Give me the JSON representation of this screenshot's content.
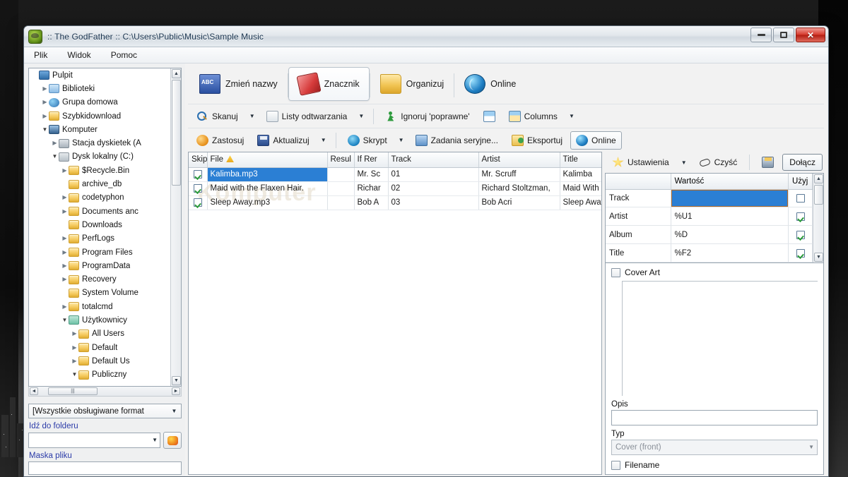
{
  "window": {
    "title": ":: The GodFather ::   C:\\Users\\Public\\Music\\Sample Music",
    "icon": "godfather-app-icon",
    "controls": {
      "minimize": "–",
      "restore": "❐",
      "close": "✕"
    }
  },
  "menubar": {
    "items": [
      "Plik",
      "Widok",
      "Pomoc"
    ]
  },
  "tabs": [
    {
      "label": "Zmień nazwy",
      "icon": "rename-icon",
      "active": false
    },
    {
      "label": "Znacznik",
      "icon": "tag-icon",
      "active": true
    },
    {
      "label": "Organizuj",
      "icon": "folder-music-icon",
      "active": false
    },
    {
      "label": "Online",
      "icon": "globe-icon",
      "active": false
    }
  ],
  "toolbar_row2": [
    {
      "label": "Skanuj",
      "icon": "search-icon",
      "caret": true
    },
    {
      "label": "Listy odtwarzania",
      "icon": "playlist-icon",
      "caret": true
    },
    {
      "label": "Ignoruj 'poprawne'",
      "icon": "run-icon",
      "caret": false
    },
    {
      "label": "",
      "icon": "window-blue-icon",
      "caret": false
    },
    {
      "label": "Columns",
      "icon": "columns-icon",
      "caret": true
    }
  ],
  "toolbar_row3": [
    {
      "label": "Zastosuj",
      "icon": "apply-icon",
      "caret": false
    },
    {
      "label": "Aktualizuj",
      "icon": "save-icon",
      "caret": true
    },
    {
      "label": "Skrypt",
      "icon": "script-icon",
      "caret": true
    },
    {
      "label": "Zadania seryjne...",
      "icon": "batch-icon",
      "caret": false
    },
    {
      "label": "Eksportuj",
      "icon": "export-icon",
      "caret": false
    },
    {
      "label": "Online",
      "icon": "online-icon",
      "caret": false,
      "framed": true
    }
  ],
  "tree": {
    "nodes": [
      {
        "label": "Pulpit",
        "depth": 0,
        "arrow": "",
        "icon": "desktop-icon"
      },
      {
        "label": "Biblioteki",
        "depth": 1,
        "arrow": "closed",
        "icon": "library-icon"
      },
      {
        "label": "Grupa domowa",
        "depth": 1,
        "arrow": "closed",
        "icon": "homegroup-icon"
      },
      {
        "label": "Szybkidownload",
        "depth": 1,
        "arrow": "closed",
        "icon": "folder-icon"
      },
      {
        "label": "Komputer",
        "depth": 1,
        "arrow": "open",
        "icon": "computer-icon"
      },
      {
        "label": "Stacja dyskietek (A",
        "depth": 2,
        "arrow": "closed",
        "icon": "floppy-icon"
      },
      {
        "label": "Dysk lokalny (C:)",
        "depth": 2,
        "arrow": "open",
        "icon": "drive-icon"
      },
      {
        "label": "$Recycle.Bin",
        "depth": 3,
        "arrow": "closed",
        "icon": "folder-icon"
      },
      {
        "label": "archive_db",
        "depth": 3,
        "arrow": "",
        "icon": "folder-icon"
      },
      {
        "label": "codetyphon",
        "depth": 3,
        "arrow": "closed",
        "icon": "folder-icon"
      },
      {
        "label": "Documents anc",
        "depth": 3,
        "arrow": "closed",
        "icon": "folder-icon"
      },
      {
        "label": "Downloads",
        "depth": 3,
        "arrow": "",
        "icon": "folder-icon"
      },
      {
        "label": "PerfLogs",
        "depth": 3,
        "arrow": "closed",
        "icon": "folder-icon"
      },
      {
        "label": "Program Files",
        "depth": 3,
        "arrow": "closed",
        "icon": "folder-icon"
      },
      {
        "label": "ProgramData",
        "depth": 3,
        "arrow": "closed",
        "icon": "folder-icon"
      },
      {
        "label": "Recovery",
        "depth": 3,
        "arrow": "closed",
        "icon": "folder-icon"
      },
      {
        "label": "System Volume",
        "depth": 3,
        "arrow": "",
        "icon": "folder-icon"
      },
      {
        "label": "totalcmd",
        "depth": 3,
        "arrow": "closed",
        "icon": "folder-icon"
      },
      {
        "label": "Użytkownicy",
        "depth": 3,
        "arrow": "open",
        "icon": "users-icon"
      },
      {
        "label": "All Users",
        "depth": 4,
        "arrow": "closed",
        "icon": "folder-icon"
      },
      {
        "label": "Default",
        "depth": 4,
        "arrow": "closed",
        "icon": "folder-icon"
      },
      {
        "label": "Default Us",
        "depth": 4,
        "arrow": "closed",
        "icon": "folder-icon"
      },
      {
        "label": "Publiczny",
        "depth": 4,
        "arrow": "open",
        "icon": "folder-icon"
      }
    ]
  },
  "left_bottom": {
    "format_filter": "[Wszystkie obsługiwane format",
    "goto_label": "Idź do folderu",
    "goto_value": "",
    "mask_label": "Maska pliku",
    "mask_value": ""
  },
  "filelist": {
    "columns": [
      "Skip",
      "File",
      "Resul",
      "If Rer",
      "Track",
      "Artist",
      "Title"
    ],
    "rows": [
      {
        "skip": true,
        "file": "Kalimba.mp3",
        "result": "",
        "ifren": "Mr. Sc",
        "track": "01",
        "artist": "Mr. Scruff",
        "title": "Kalimba",
        "selected": true
      },
      {
        "skip": true,
        "file": "Maid with the Flaxen Hair.",
        "result": "",
        "ifren": "Richar",
        "track": "02",
        "artist": "Richard Stoltzman,",
        "title": "Maid With t",
        "selected": false
      },
      {
        "skip": true,
        "file": "Sleep Away.mp3",
        "result": "",
        "ifren": "Bob A",
        "track": "03",
        "artist": "Bob Acri",
        "title": "Sleep Away",
        "selected": false
      }
    ],
    "watermark": "Komputer"
  },
  "tagpanel": {
    "tools": [
      {
        "label": "Ustawienia",
        "icon": "star-icon",
        "caret": true
      },
      {
        "label": "Czyść",
        "icon": "eraser-icon",
        "caret": false
      },
      {
        "label": "",
        "icon": "print-icon",
        "caret": false
      }
    ],
    "attach_button": "Dołącz",
    "table": {
      "columns": [
        "",
        "Wartość",
        "Użyj"
      ],
      "rows": [
        {
          "field": "Track",
          "value": "",
          "use": false,
          "value_selected": true
        },
        {
          "field": "Artist",
          "value": "%U1",
          "use": true,
          "value_selected": false
        },
        {
          "field": "Album",
          "value": "%D",
          "use": true,
          "value_selected": false
        },
        {
          "field": "Title",
          "value": "%F2",
          "use": true,
          "value_selected": false
        }
      ]
    },
    "cover_art_label": "Cover Art",
    "cover_art_checked": false,
    "opis_label": "Opis",
    "opis_value": "",
    "typ_label": "Typ",
    "typ_value": "Cover (front)",
    "filename_label": "Filename",
    "filename_checked": false
  },
  "colors": {
    "selection_blue": "#2b7fd4",
    "link_blue": "#2b3ba8",
    "close_red": "#d63b2e"
  }
}
